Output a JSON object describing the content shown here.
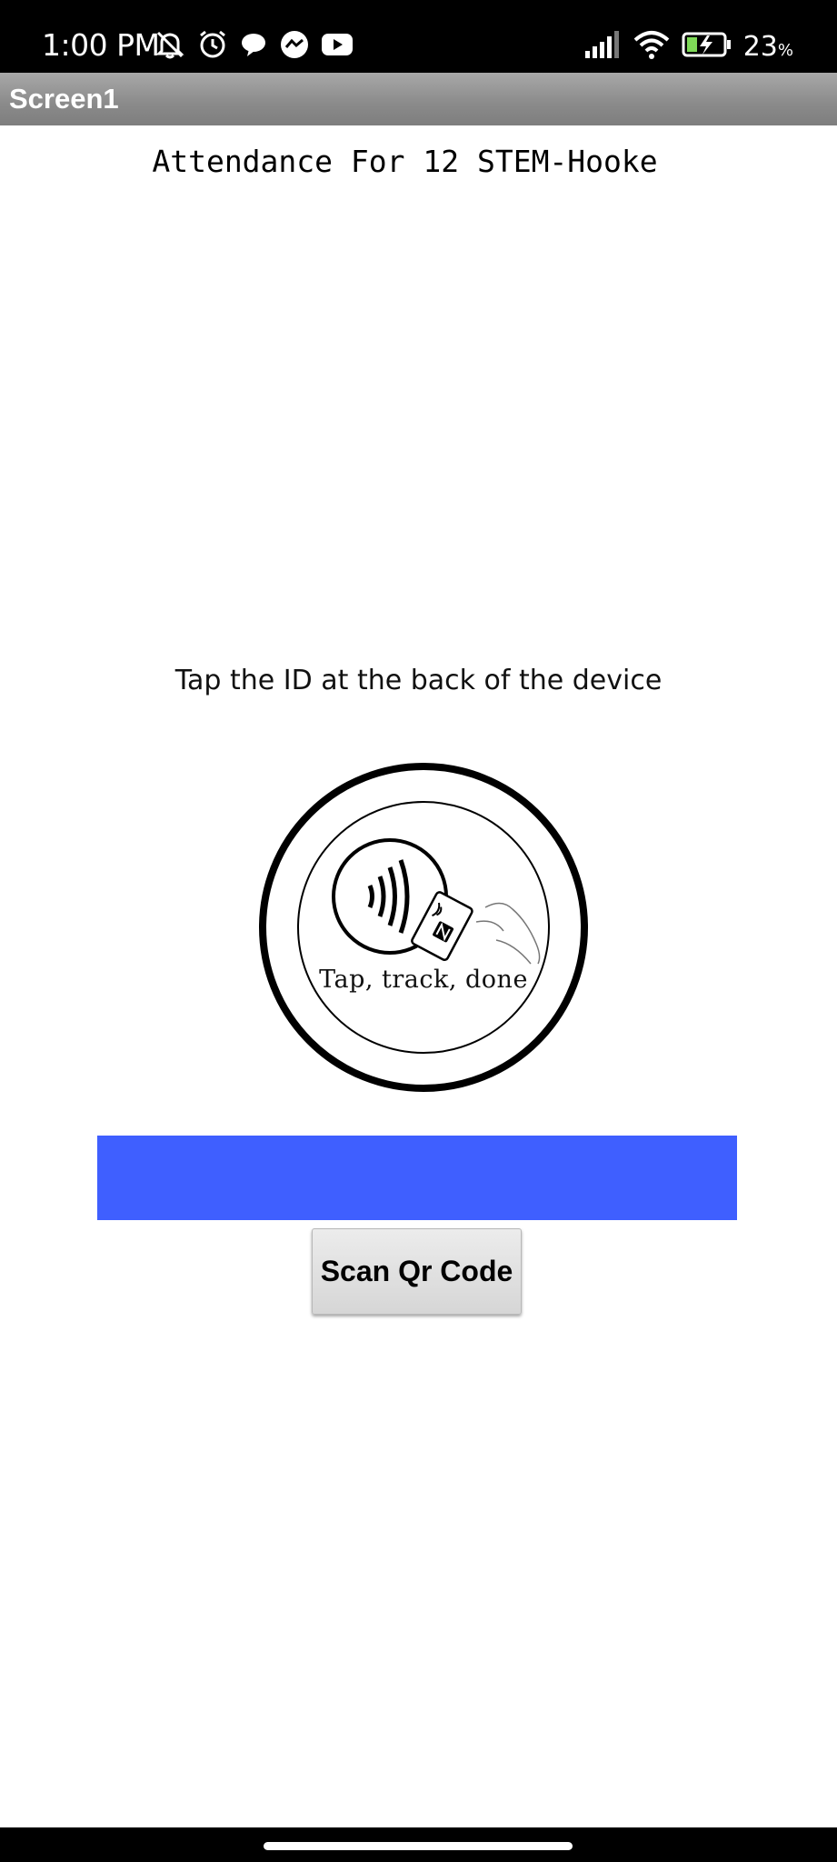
{
  "status_bar": {
    "time": "1:00 PM",
    "battery_percent": "23",
    "battery_unit": "%",
    "icons_left": [
      "mute-icon",
      "alarm-icon",
      "chat-icon",
      "messenger-icon",
      "youtube-icon"
    ],
    "icons_right": [
      "signal-icon",
      "wifi-icon",
      "battery-charging-icon"
    ]
  },
  "app": {
    "title": "Screen1"
  },
  "main": {
    "heading": "Attendance For 12 STEM-Hooke",
    "instruction": "Tap the ID at the back of the device",
    "logo_caption": "Tap, track, done",
    "progress_color": "#3f5fff",
    "scan_button_label": "Scan Qr Code"
  }
}
